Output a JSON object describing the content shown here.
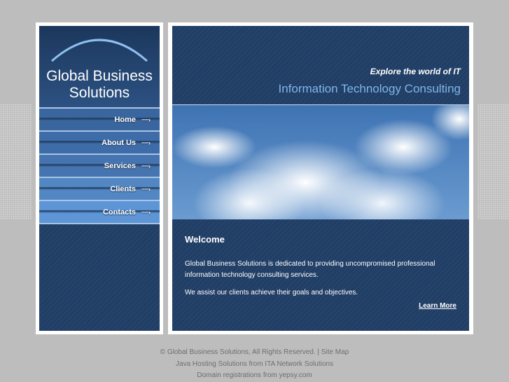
{
  "logo": {
    "line1": "Global Business",
    "line2": "Solutions"
  },
  "menu": [
    {
      "label": "Home",
      "color": "#3a66a0"
    },
    {
      "label": "About Us",
      "color": "#3e6ca8"
    },
    {
      "label": "Services",
      "color": "#4674b0"
    },
    {
      "label": "Clients",
      "color": "#5387c4"
    },
    {
      "label": "Contacts",
      "color": "#5e95d6"
    }
  ],
  "menu_arrow": "·····›",
  "header": {
    "tagline": "Explore the world of IT",
    "title": "Information Technology Consulting"
  },
  "content": {
    "heading": "Welcome",
    "para1": "Global Business Solutions is dedicated to providing uncompromised professional information technology consulting services.",
    "para2": "We assist our clients achieve their goals and objectives.",
    "learn_more": "Learn More"
  },
  "footer": {
    "copyright": "© Global Business Solutions, All Rights Reserved.",
    "separator": " | ",
    "site_map": "Site Map",
    "line2": "Java Hosting Solutions from ITA Network Solutions",
    "line3": "Domain registrations from yepsy.com"
  }
}
